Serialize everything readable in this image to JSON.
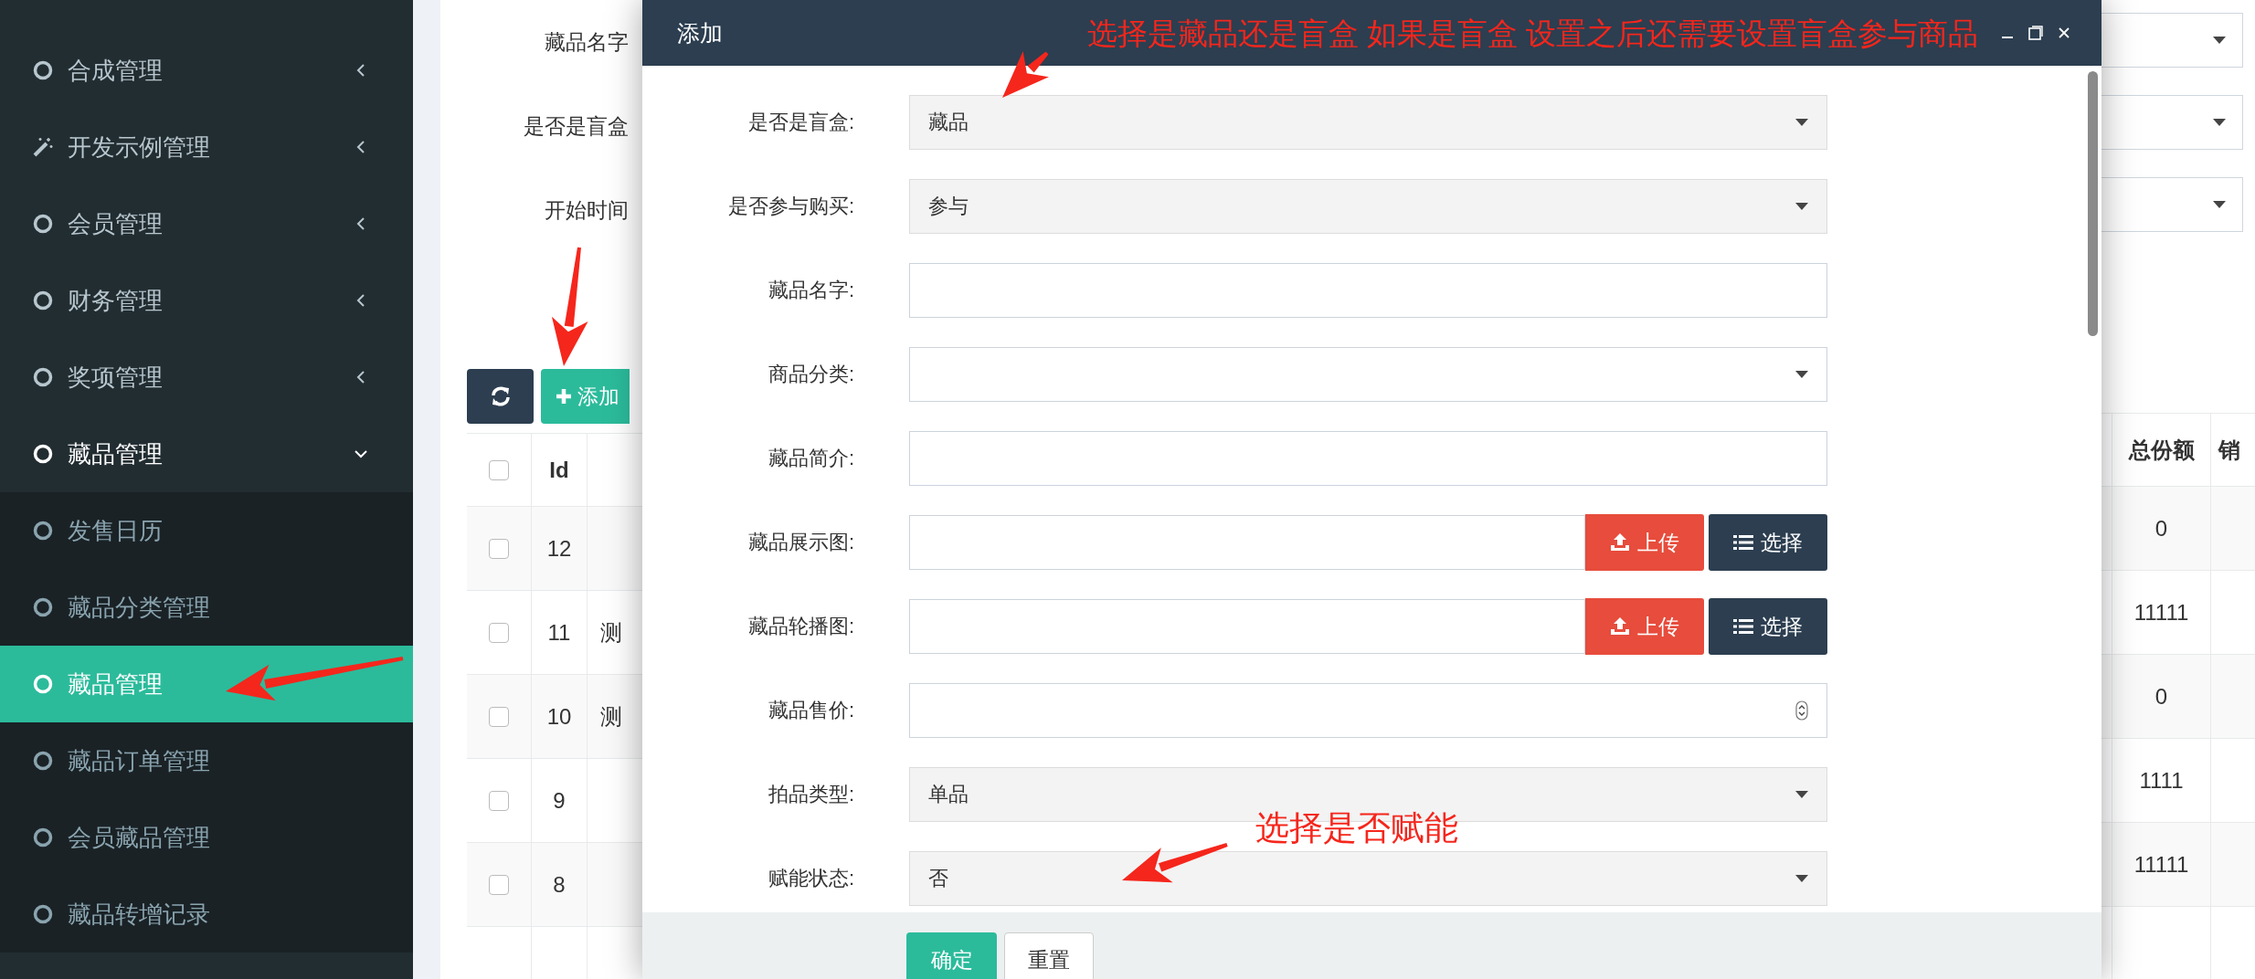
{
  "sidebar": {
    "items": [
      {
        "label": "合成管理",
        "kind": "circle",
        "expanded": false
      },
      {
        "label": "开发示例管理",
        "kind": "wand",
        "expanded": false
      },
      {
        "label": "会员管理",
        "kind": "circle",
        "expanded": false
      },
      {
        "label": "财务管理",
        "kind": "circle",
        "expanded": false
      },
      {
        "label": "奖项管理",
        "kind": "circle",
        "expanded": false
      },
      {
        "label": "藏品管理",
        "kind": "circle",
        "expanded": true,
        "children": [
          {
            "label": "发售日历",
            "selected": false
          },
          {
            "label": "藏品分类管理",
            "selected": false
          },
          {
            "label": "藏品管理",
            "selected": true
          },
          {
            "label": "藏品订单管理",
            "selected": false
          },
          {
            "label": "会员藏品管理",
            "selected": false
          },
          {
            "label": "藏品转增记录",
            "selected": false
          }
        ]
      }
    ]
  },
  "filters": [
    {
      "label": "藏品名字"
    },
    {
      "label": "是否是盲盒"
    },
    {
      "label": "开始时间"
    }
  ],
  "toolbar": {
    "add_button": "添加"
  },
  "table": {
    "all_checked": false,
    "columns": [
      "Id",
      "总份额",
      "销"
    ],
    "rows": [
      {
        "checked": false,
        "id": "12",
        "total": "0"
      },
      {
        "checked": false,
        "id": "11",
        "column_3": "测",
        "total": "11111"
      },
      {
        "checked": false,
        "id": "10",
        "column_3": "测",
        "total": "0"
      },
      {
        "checked": false,
        "id": "9",
        "total": "1111"
      },
      {
        "checked": false,
        "id": "8",
        "total": "11111"
      }
    ]
  },
  "dialog": {
    "title": "添加",
    "fields": [
      {
        "kind": "select",
        "label": "是否是盲盒:",
        "value": "藏品"
      },
      {
        "kind": "select",
        "label": "是否参与购买:",
        "value": "参与"
      },
      {
        "kind": "text",
        "label": "藏品名字:"
      },
      {
        "kind": "select",
        "label": "商品分类:"
      },
      {
        "kind": "text",
        "label": "藏品简介:"
      },
      {
        "kind": "upload",
        "label": "藏品展示图:",
        "upload": "上传",
        "choose": "选择"
      },
      {
        "kind": "upload",
        "label": "藏品轮播图:",
        "upload": "上传",
        "choose": "选择"
      },
      {
        "kind": "number",
        "label": "藏品售价:"
      },
      {
        "kind": "select",
        "label": "拍品类型:",
        "value": "单品"
      },
      {
        "kind": "select",
        "label": "赋能状态:",
        "value": "否"
      }
    ],
    "buttons": [
      "确定",
      "重置"
    ]
  },
  "annotations": [
    {
      "text": "选择是藏品还是盲盒 如果是盲盒 设置之后还需要设置盲盒参与商品"
    },
    {
      "text": "选择是否赋能"
    }
  ]
}
